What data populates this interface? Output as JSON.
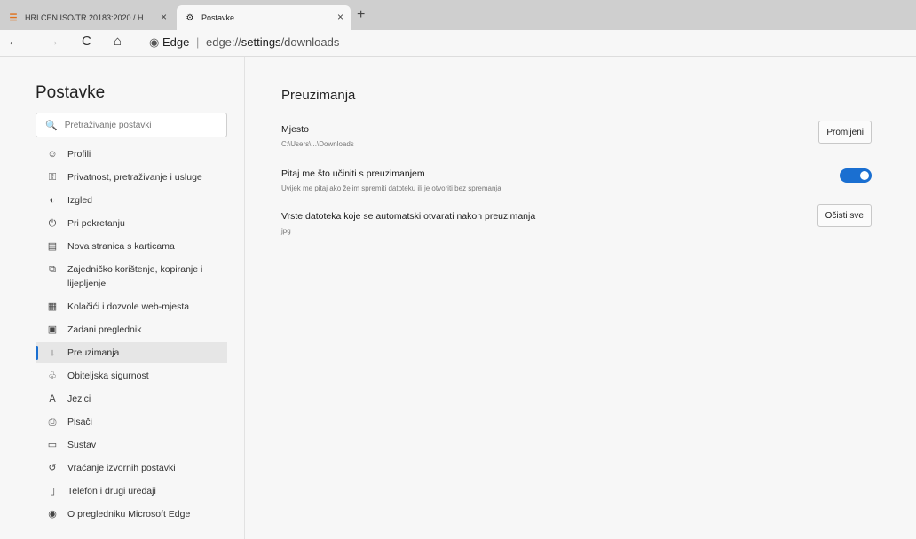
{
  "browser": {
    "tabs": [
      {
        "title": "HRI CEN ISO/TR 20183:2020 / H",
        "icon": "hri-logo-icon",
        "close": "×"
      },
      {
        "title": "Postavke",
        "icon": "gear-icon",
        "close": "×"
      }
    ],
    "new_tab": "+",
    "nav": {
      "back": "←",
      "forward": "→",
      "refresh": "C",
      "home": "⌂"
    },
    "address": {
      "brand": "Edge",
      "separator": "|",
      "prefix": "edge://",
      "path_bold": "settings",
      "path_rest": "/downloads"
    }
  },
  "sidebar": {
    "title": "Postavke",
    "search_placeholder": "Pretraživanje postavki",
    "items": [
      {
        "label": "Profili",
        "icon": "profile-icon",
        "glyph": "☺"
      },
      {
        "label": "Privatnost, pretraživanje i usluge",
        "icon": "lock-icon",
        "glyph": "⚿"
      },
      {
        "label": "Izgled",
        "icon": "appearance-icon",
        "glyph": "◐"
      },
      {
        "label": "Pri pokretanju",
        "icon": "power-icon",
        "glyph": "⏻"
      },
      {
        "label": "Nova stranica s karticama",
        "icon": "newtab-page-icon",
        "glyph": "▤"
      },
      {
        "label": "Zajedničko korištenje, kopiranje i lijepljenje",
        "icon": "share-icon",
        "glyph": "⧉"
      },
      {
        "label": "Kolačići i dozvole web-mjesta",
        "icon": "cookies-icon",
        "glyph": "▦"
      },
      {
        "label": "Zadani preglednik",
        "icon": "default-browser-icon",
        "glyph": "▣"
      },
      {
        "label": "Preuzimanja",
        "icon": "download-icon",
        "glyph": "↓"
      },
      {
        "label": "Obiteljska sigurnost",
        "icon": "family-icon",
        "glyph": "♧"
      },
      {
        "label": "Jezici",
        "icon": "languages-icon",
        "glyph": "A"
      },
      {
        "label": "Pisači",
        "icon": "printer-icon",
        "glyph": "⎙"
      },
      {
        "label": "Sustav",
        "icon": "system-icon",
        "glyph": "▭"
      },
      {
        "label": "Vraćanje izvornih postavki",
        "icon": "reset-icon",
        "glyph": "↺"
      },
      {
        "label": "Telefon i drugi uređaji",
        "icon": "phone-icon",
        "glyph": "▯"
      },
      {
        "label": "O pregledniku Microsoft Edge",
        "icon": "edge-icon",
        "glyph": "◉"
      }
    ],
    "active_index": 8
  },
  "main": {
    "title": "Preuzimanja",
    "location": {
      "label": "Mjesto",
      "value": "C:\\Users\\...\\Downloads",
      "button": "Promijeni"
    },
    "ask": {
      "label": "Pitaj me što učiniti s preuzimanjem",
      "description": "Uvijek me pitaj ako želim spremiti datoteku ili je otvoriti bez spremanja",
      "enabled": true
    },
    "filetypes": {
      "label": "Vrste datoteka koje se automatski otvarati nakon preuzimanja",
      "value": "jpg",
      "button": "Očisti sve"
    }
  },
  "colors": {
    "accent": "#1a6fd1"
  }
}
